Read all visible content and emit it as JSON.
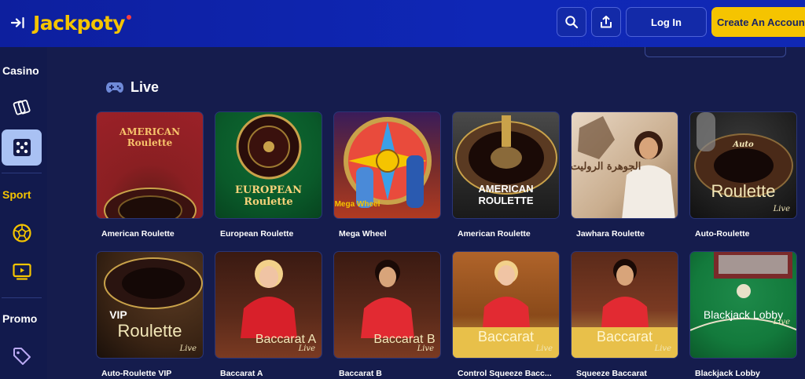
{
  "header": {
    "logo_text": "Jackpoty",
    "login_label": "Log In",
    "create_account_label": "Create An Account",
    "icons": [
      "collapse-sidebar-icon",
      "search-icon",
      "share-icon"
    ]
  },
  "sidebar": {
    "casino_label": "Casino",
    "sport_label": "Sport",
    "promo_label": "Promo",
    "items": [
      {
        "name": "cards-icon"
      },
      {
        "name": "dice-icon"
      },
      {
        "name": "football-icon"
      },
      {
        "name": "tv-icon"
      },
      {
        "name": "tag-icon"
      }
    ]
  },
  "section": {
    "title": "Live",
    "icon": "gamepad-icon"
  },
  "games": [
    {
      "title": "American Roulette",
      "art": "AMERICAN Roulette"
    },
    {
      "title": "European Roulette",
      "art": "EUROPEAN Roulette"
    },
    {
      "title": "Mega Wheel",
      "art": "Mega Wheel"
    },
    {
      "title": "American Roulette",
      "art": "AMERICAN ROULETTE"
    },
    {
      "title": "Jawhara Roulette",
      "art": "الجوهرة الروليت"
    },
    {
      "title": "Auto-Roulette",
      "art": "Roulette",
      "art_sub": "Auto",
      "live": "Live"
    },
    {
      "title": "Auto-Roulette VIP",
      "art": "Roulette",
      "art_sub": "VIP",
      "live": "Live"
    },
    {
      "title": "Baccarat A",
      "art": "Baccarat A",
      "live": "Live"
    },
    {
      "title": "Baccarat B",
      "art": "Baccarat B",
      "live": "Live"
    },
    {
      "title": "Control Squeeze Bacc...",
      "art": "Baccarat",
      "live": "Live"
    },
    {
      "title": "Squeeze Baccarat",
      "art": "Baccarat",
      "live": "Live"
    },
    {
      "title": "Blackjack Lobby",
      "art": "Blackjack Lobby",
      "live": "Live"
    }
  ],
  "colors": {
    "brand_yellow": "#f5c400",
    "header_blue": "#0f27b6",
    "background": "#151c4d"
  }
}
